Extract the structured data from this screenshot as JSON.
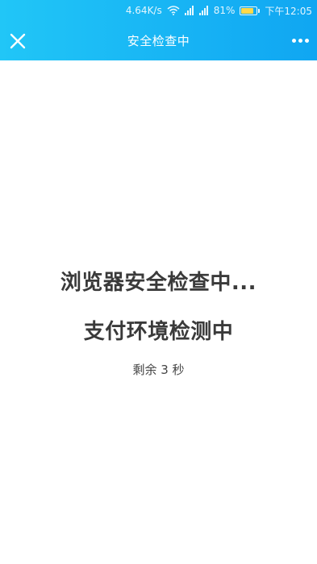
{
  "status_bar": {
    "network_speed": "4.64K/s",
    "battery_percent": "81%",
    "battery_level": 0.81,
    "time": "下午12:05",
    "icons": [
      "wifi-icon",
      "signal-icon",
      "signal-icon",
      "battery-icon"
    ]
  },
  "nav": {
    "title": "安全检查中",
    "close_icon": "close-icon",
    "more_icon": "more-icon"
  },
  "main": {
    "line1": "浏览器安全检查中...",
    "line2": "支付环境检测中",
    "countdown": "剩余 3 秒"
  },
  "colors": {
    "header_start": "#21c6f7",
    "header_end": "#10a6f2",
    "text": "#3a3a3a"
  }
}
